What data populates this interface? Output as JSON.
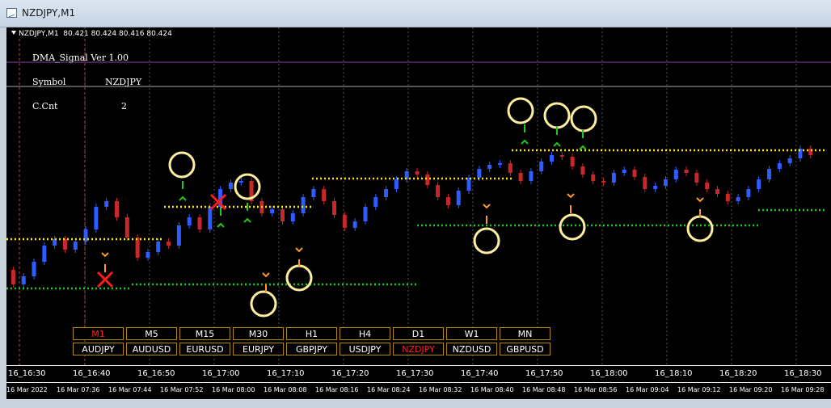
{
  "window": {
    "title": "NZDJPY,M1"
  },
  "chart_header": {
    "symbol_tf": "NZDJPY,M1",
    "ohlc": "80.421 80.424 80.416 80.424"
  },
  "indicator": {
    "name": "DMA_Signal  Ver 1.00",
    "symbol_label": "Symbol",
    "symbol_value": "NZDJPY",
    "cnt_label": "C.Cnt",
    "cnt_value": "2"
  },
  "colors": {
    "bull": "#2f5cff",
    "bear": "#c8282a",
    "resistance": "#ffe600",
    "support": "#1ec81e",
    "circle": "#ffeea0",
    "active": "#ff2020"
  },
  "timeframes": [
    {
      "label": "M1",
      "active": true
    },
    {
      "label": "M5",
      "active": false
    },
    {
      "label": "M15",
      "active": false
    },
    {
      "label": "M30",
      "active": false
    },
    {
      "label": "H1",
      "active": false
    },
    {
      "label": "H4",
      "active": false
    },
    {
      "label": "D1",
      "active": false
    },
    {
      "label": "W1",
      "active": false
    },
    {
      "label": "MN",
      "active": false
    }
  ],
  "symbols": [
    {
      "label": "AUDJPY",
      "active": false
    },
    {
      "label": "AUDUSD",
      "active": false
    },
    {
      "label": "EURUSD",
      "active": false
    },
    {
      "label": "EURJPY",
      "active": false
    },
    {
      "label": "GBPJPY",
      "active": false
    },
    {
      "label": "USDJPY",
      "active": false
    },
    {
      "label": "NZDJPY",
      "active": true
    },
    {
      "label": "NZDUSD",
      "active": false
    },
    {
      "label": "GBPUSD",
      "active": false
    }
  ],
  "time_axis_top": [
    "16_16:30",
    "16_16:40",
    "16_16:50",
    "16_17:00",
    "16_17:10",
    "16_17:20",
    "16_17:30",
    "16_17:40",
    "16_17:50",
    "16_18:00",
    "16_18:10",
    "16_18:20",
    "16_18:30"
  ],
  "time_axis_bottom": [
    "16 Mar 2022",
    "16 Mar 07:36",
    "16 Mar 07:44",
    "16 Mar 07:52",
    "16 Mar 08:00",
    "16 Mar 08:08",
    "16 Mar 08:16",
    "16 Mar 08:24",
    "16 Mar 08:32",
    "16 Mar 08:40",
    "16 Mar 08:48",
    "16 Mar 08:56",
    "16 Mar 09:04",
    "16 Mar 09:12",
    "16 Mar 09:20",
    "16 Mar 09:28"
  ]
}
